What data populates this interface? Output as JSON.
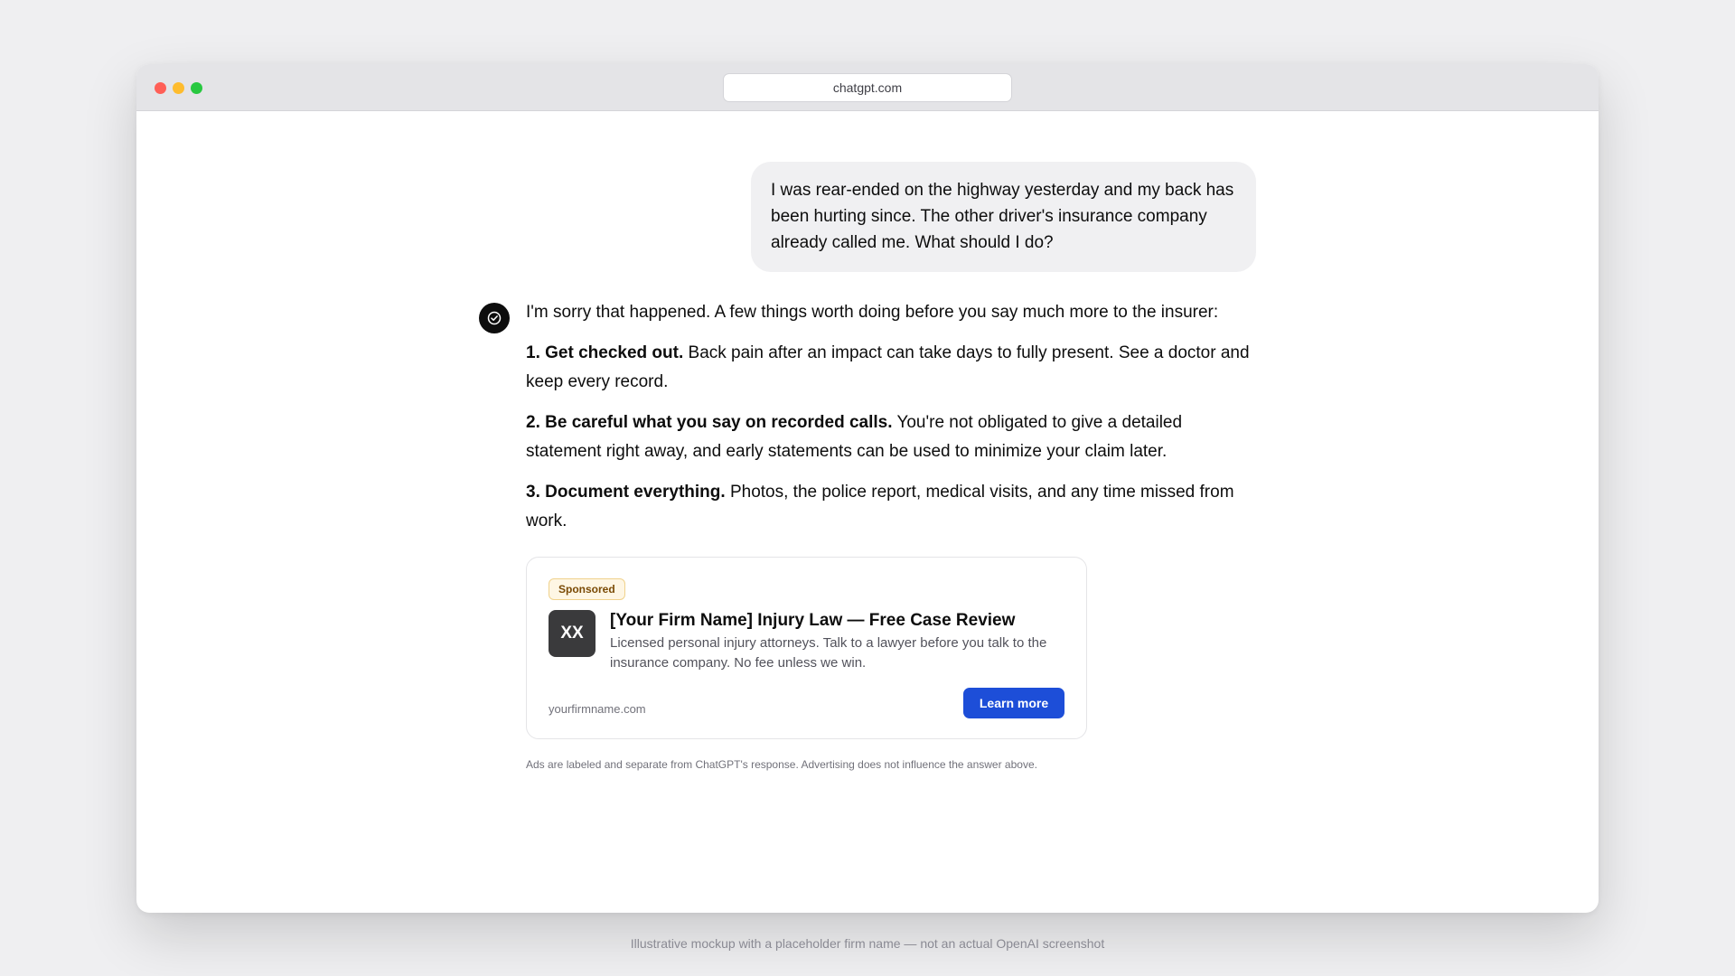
{
  "browser": {
    "url": "chatgpt.com",
    "controls": {
      "close_color": "#ff5f57",
      "minimize_color": "#febc2e",
      "maximize_color": "#28c840"
    }
  },
  "conversation": {
    "user_message": "I was rear-ended on the highway yesterday and my back has been hurting since. The other driver's insurance company already called me. What should I do?",
    "assistant": {
      "avatar_icon": "assistant-logo-icon",
      "intro": "I'm sorry that happened. A few things worth doing before you say much more to the insurer:",
      "points": [
        {
          "title": "1. Get checked out.",
          "body": "Back pain after an impact can take days to fully present. See a doctor and keep every record."
        },
        {
          "title": "2. Be careful what you say on recorded calls.",
          "body": "You're not obligated to give a detailed statement right away, and early statements can be used to minimize your claim later."
        },
        {
          "title": "3. Document everything.",
          "body": "Photos, the police report, medical visits, and any time missed from work."
        }
      ]
    }
  },
  "ad": {
    "badge": "Sponsored",
    "logo_text": "XX",
    "title": "[Your Firm Name] Injury Law — Free Case Review",
    "description": "Licensed personal injury attorneys. Talk to a lawyer before you talk to the insurance company. No fee unless we win.",
    "domain": "yourfirmname.com",
    "cta_label": "Learn more",
    "cta_color": "#1d4ed8"
  },
  "disclaimer": "Ads are labeled and separate from ChatGPT's response. Advertising does not influence the answer above.",
  "caption": "Illustrative mockup with a placeholder firm name — not an actual OpenAI screenshot"
}
